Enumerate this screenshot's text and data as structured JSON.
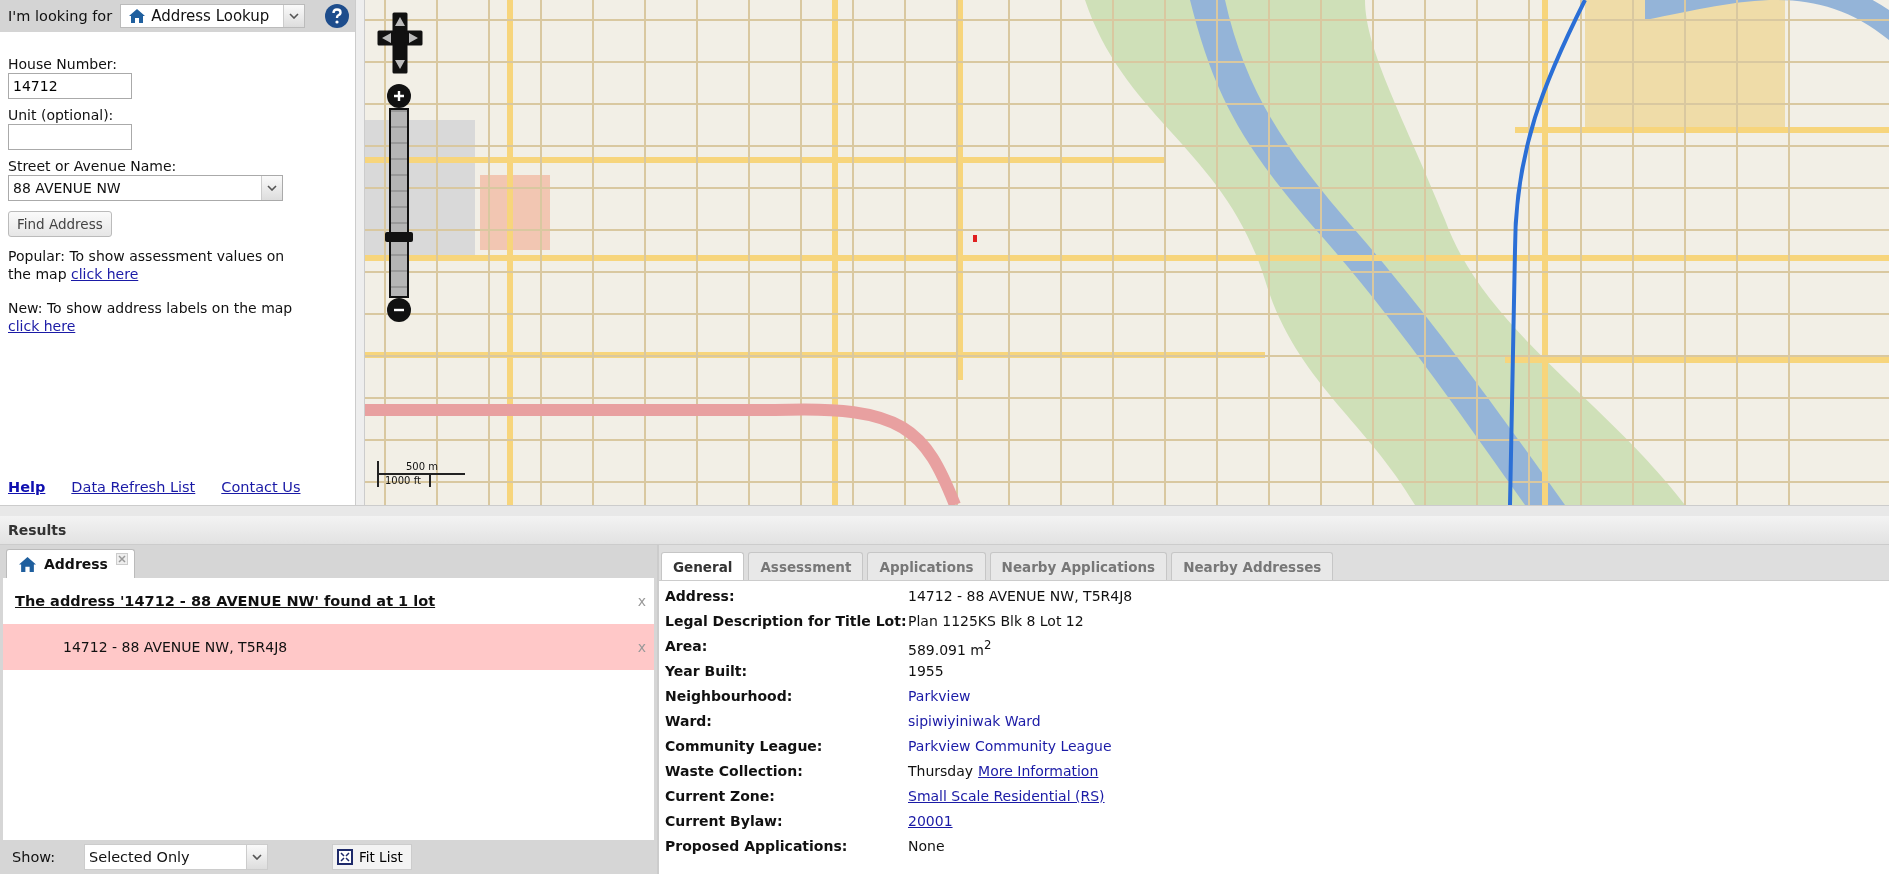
{
  "search_bar": {
    "label": "I'm looking for",
    "selected_option": "Address Lookup"
  },
  "form": {
    "fields": [
      {
        "label": "House Number:",
        "value": "14712",
        "kind": "input"
      },
      {
        "label": "Unit (optional):",
        "kind": "input"
      },
      {
        "label": "Street or Avenue Name:",
        "value": "88 AVENUE NW",
        "kind": "select"
      }
    ],
    "submit": "Find Address",
    "notes": [
      {
        "text": "Popular: To show assessment values on the map",
        "link": "click here"
      },
      {
        "text": "New: To show address labels on the map",
        "link": "click here"
      }
    ],
    "footer_links": [
      {
        "text": "Help",
        "bold": true
      },
      {
        "text": "Data Refresh List",
        "bold": false
      },
      {
        "text": "Contact Us",
        "bold": false
      }
    ]
  },
  "map": {
    "zoom": {
      "level": 0.35
    },
    "scale": {
      "metric": "500 m",
      "imperial": "1000 ft"
    }
  },
  "results": {
    "title": "Results",
    "tabs": [
      {
        "label": "Address",
        "selected": true
      }
    ],
    "heading": "The address '14712 - 88 AVENUE NW' found at 1 lot",
    "heading_close": "x",
    "items": [
      {
        "text": "14712 - 88 AVENUE NW, T5R4J8",
        "close": "x",
        "selected": true
      }
    ],
    "show_label": "Show:",
    "show_value": "Selected Only",
    "fit_button": "Fit List"
  },
  "details": {
    "tabs": [
      {
        "label": "General",
        "selected": true
      },
      {
        "label": "Assessment",
        "selected": false
      },
      {
        "label": "Applications",
        "selected": false
      },
      {
        "label": "Nearby Applications",
        "selected": false
      },
      {
        "label": "Nearby Addresses",
        "selected": false
      }
    ],
    "rows": [
      {
        "label": "Address:",
        "value": [
          {
            "text": "14712 - 88 AVENUE NW, T5R4J8",
            "kind": "text"
          }
        ]
      },
      {
        "label": "Legal Description for Title Lot:",
        "value": [
          {
            "text": "Plan 1125KS Blk 8 Lot 12",
            "kind": "text"
          }
        ]
      },
      {
        "label": "Area:",
        "value": [
          {
            "text": "589.091 m$^{2}$",
            "kind": "text"
          }
        ]
      },
      {
        "label": "Year Built:",
        "value": [
          {
            "text": "1955",
            "kind": "text"
          }
        ]
      },
      {
        "label": "Neighbourhood:",
        "value": [
          {
            "text": "Parkview",
            "kind": "plain_link"
          }
        ]
      },
      {
        "label": "Ward:",
        "value": [
          {
            "text": "sipiwiyiniwak Ward",
            "kind": "plain_link"
          }
        ]
      },
      {
        "label": "Community League:",
        "value": [
          {
            "text": "Parkview Community League",
            "kind": "plain_link"
          }
        ]
      },
      {
        "label": "Waste Collection:",
        "value": [
          {
            "text": "Thursday",
            "kind": "text"
          },
          {
            "text": "More Information",
            "kind": "link"
          }
        ]
      },
      {
        "label": "Current Zone:",
        "value": [
          {
            "text": "Small Scale Residential (RS)",
            "kind": "link"
          }
        ]
      },
      {
        "label": "Current Bylaw:",
        "value": [
          {
            "text": "20001",
            "kind": "link"
          }
        ]
      },
      {
        "label": "Proposed Applications:",
        "value": [
          {
            "text": "None",
            "kind": "text"
          }
        ]
      }
    ]
  }
}
